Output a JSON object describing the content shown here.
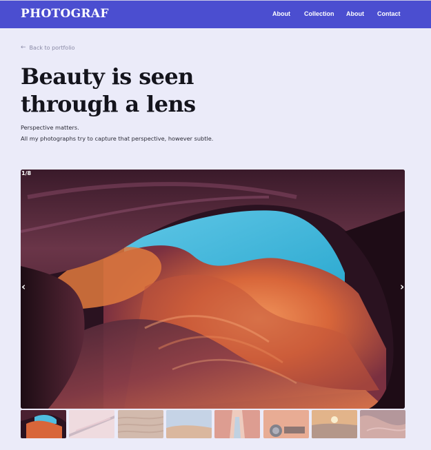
{
  "header": {
    "logo": "PHOTOGRAF",
    "nav": [
      "About",
      "Collection",
      "About",
      "Contact"
    ]
  },
  "back_link": "Back to portfolio",
  "hero": {
    "title_line1": "Beauty is seen",
    "title_line2": "through a lens",
    "subtitle_line1": "Perspective matters.",
    "subtitle_line2": "All my photographs try to capture that perspective, however subtle."
  },
  "gallery": {
    "counter": "1/8",
    "prev_glyph": "‹",
    "next_glyph": "›",
    "image_name": "antelope-canyon-photo"
  },
  "colors": {
    "nav_bg": "#4b4ed0",
    "page_bg": "#ebebf9",
    "text": "#14141c"
  }
}
